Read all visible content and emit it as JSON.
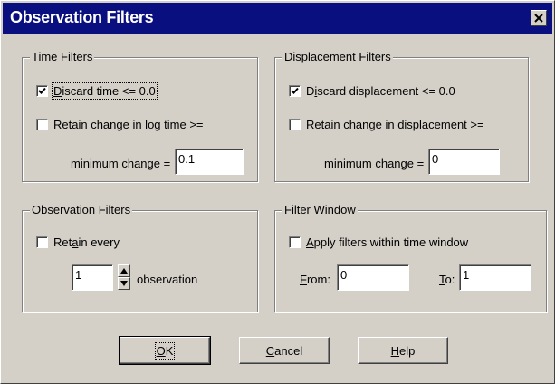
{
  "dialog": {
    "title": "Observation Filters",
    "close_icon": "close-icon"
  },
  "time_filters": {
    "group_label": "Time Filters",
    "discard": {
      "pre": "",
      "ul": "D",
      "post": "iscard time <= 0.0",
      "checked": true
    },
    "retain": {
      "pre": "",
      "ul": "R",
      "post": "etain change in log time >=",
      "checked": false
    },
    "min_change_label": "minimum change =",
    "min_change_value": "0.1"
  },
  "displacement_filters": {
    "group_label": "Displacement Filters",
    "discard": {
      "pre": "D",
      "ul": "i",
      "post": "scard displacement <= 0.0",
      "checked": true
    },
    "retain": {
      "pre": "R",
      "ul": "e",
      "post": "tain change in displacement >=",
      "checked": false
    },
    "min_change_label": "minimum change =",
    "min_change_value": "0"
  },
  "observation_filters": {
    "group_label": "Observation Filters",
    "retain_every": {
      "pre": "Ret",
      "ul": "a",
      "post": "in every",
      "checked": false
    },
    "value": "1",
    "suffix": "observation"
  },
  "filter_window": {
    "group_label": "Filter Window",
    "apply": {
      "pre": "",
      "ul": "A",
      "post": "pply filters within time window",
      "checked": false
    },
    "from": {
      "ul": "F",
      "post": "rom:",
      "value": "0"
    },
    "to": {
      "ul": "T",
      "post": "o:",
      "value": "1"
    }
  },
  "buttons": {
    "ok": {
      "ul": "O",
      "post": "K"
    },
    "cancel": {
      "ul": "C",
      "post": "ancel"
    },
    "help": {
      "ul": "H",
      "post": "elp"
    }
  },
  "colors": {
    "titlebar": "#0a0f80",
    "face": "#d4d0c8"
  }
}
